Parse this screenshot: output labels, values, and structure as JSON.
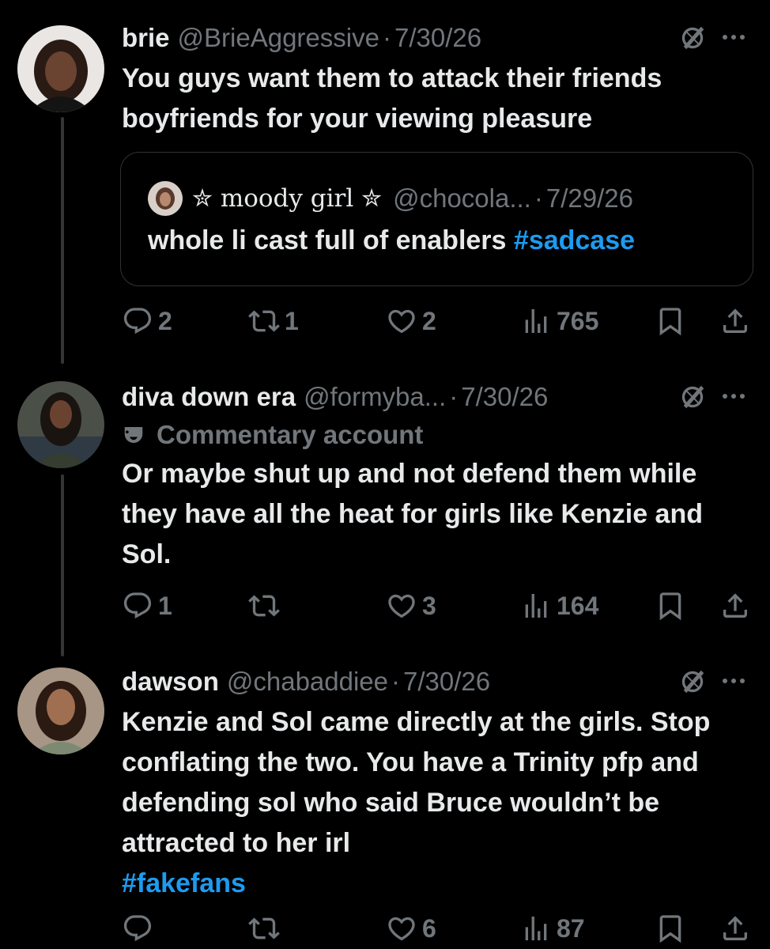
{
  "thread": [
    {
      "name": "brie",
      "handle": "@BrieAggressive",
      "separator": "·",
      "date": "7/30/26",
      "text": "You guys want them to attack their friends boyfriends for your viewing pleasure",
      "quote": {
        "name": "✮ moody girl ✮",
        "handle": "@chocola...",
        "separator": "·",
        "date": "7/29/26",
        "text": "whole li cast full of enablers",
        "hashtag": "#sadcase"
      },
      "stats": {
        "replies": "2",
        "reposts": "1",
        "likes": "2",
        "views": "765"
      }
    },
    {
      "name": "diva down era",
      "handle": "@formyba...",
      "separator": "·",
      "date": "7/30/26",
      "label": "Commentary account",
      "text": "Or maybe shut up and not defend them while they have all the heat for girls like Kenzie and Sol.",
      "stats": {
        "replies": "1",
        "reposts": "",
        "likes": "3",
        "views": "164"
      }
    },
    {
      "name": "dawson",
      "handle": "@chabaddiee",
      "separator": "·",
      "date": "7/30/26",
      "text": "Kenzie and Sol came directly at the girls. Stop conflating the two. You have a Trinity pfp and defending sol who said Bruce wouldn’t be attracted to her irl",
      "hashtag": "#fakefans",
      "stats": {
        "replies": "",
        "reposts": "",
        "likes": "6",
        "views": "87"
      }
    }
  ],
  "icons": {
    "reply": "reply-icon",
    "repost": "repost-icon",
    "like": "heart-icon",
    "views": "views-icon",
    "bookmark": "bookmark-icon",
    "share": "share-icon",
    "more": "more-icon",
    "grok": "grok-icon",
    "commentary": "mask-icon"
  },
  "colors": {
    "background": "#000000",
    "text": "#e7e9ea",
    "muted": "#71767b",
    "link": "#1d9bf0",
    "border": "#2f3336"
  }
}
